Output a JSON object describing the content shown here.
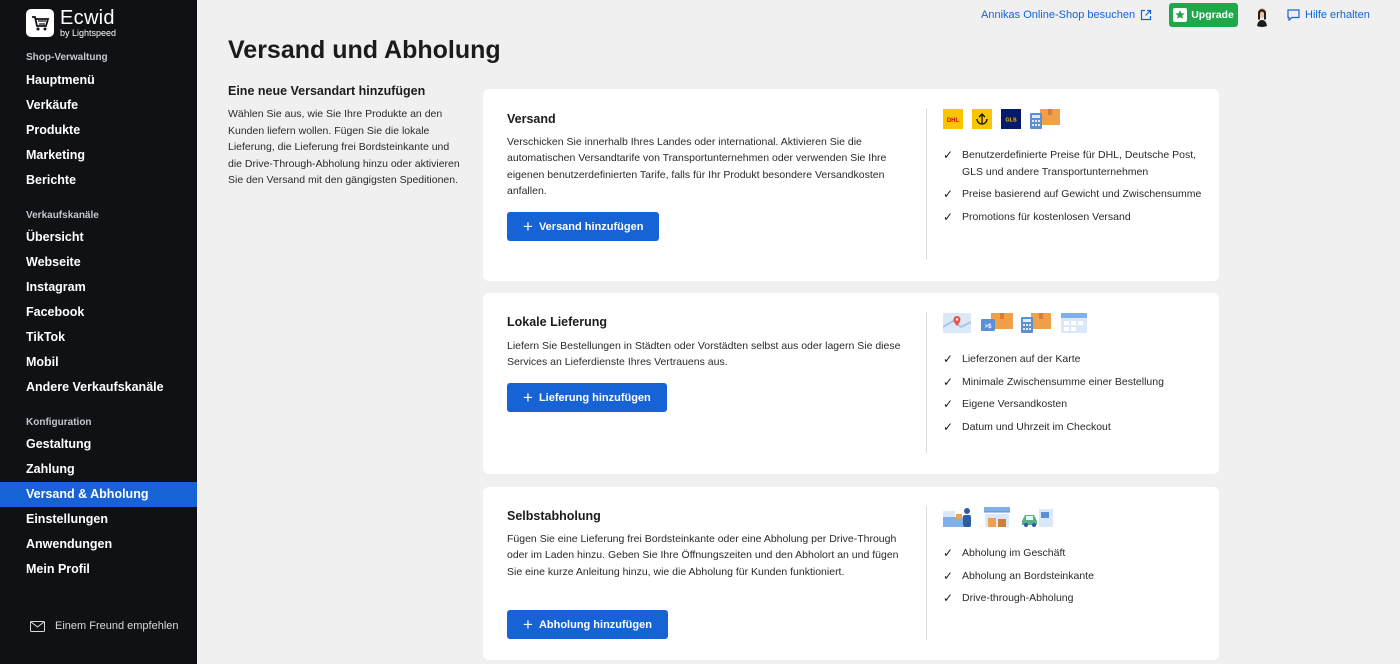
{
  "app": {
    "name": "Ecwid",
    "sub": "by Lightspeed"
  },
  "sidebar": {
    "section_shop": "Shop-Verwaltung",
    "section_channels": "Verkaufskanäle",
    "section_config": "Konfiguration",
    "shop_items": [
      "Hauptmenü",
      "Verkäufe",
      "Produkte",
      "Marketing",
      "Berichte"
    ],
    "channel_items": [
      "Übersicht",
      "Webseite",
      "Instagram",
      "Facebook",
      "TikTok",
      "Mobil",
      "Andere Verkaufskanäle"
    ],
    "config_items": [
      "Gestaltung",
      "Zahlung",
      "Versand & Abholung",
      "Einstellungen",
      "Anwendungen",
      "Mein Profil"
    ],
    "active_item": "Versand & Abholung",
    "refer_label": "Einem Freund empfehlen"
  },
  "topbar": {
    "visit_label": "Annikas Online-Shop besuchen",
    "upgrade_label": "Upgrade",
    "help_label": "Hilfe erhalten"
  },
  "page": {
    "title": "Versand und Abholung",
    "intro_heading": "Eine neue Versandart hinzufügen",
    "intro_text": "Wählen Sie aus, wie Sie Ihre Produkte an den Kunden liefern wollen. Fügen Sie die lokale Lieferung, die Lieferung frei Bordsteinkante und die Drive-Through-Abholung hinzu oder aktivieren Sie den Versand mit den gängigsten Speditionen."
  },
  "cards": [
    {
      "title": "Versand",
      "description": "Verschicken Sie innerhalb Ihres Landes oder international. Aktivieren Sie die automatischen Versandtarife von Transportunternehmen oder verwenden Sie Ihre eigenen benutzerdefinierten Tarife, falls für Ihr Produkt besondere Versandkosten anfallen.",
      "button": "Versand hinzufügen",
      "icons": [
        "dhl-logo-icon",
        "deutsche-post-logo-icon",
        "gls-logo-icon",
        "calculator-box-icon"
      ],
      "features": [
        "Benutzerdefinierte Preise für DHL, Deutsche Post, GLS und andere Transportunternehmen",
        "Preise basierend auf Gewicht und Zwischensumme",
        "Promotions für kostenlosen Versand"
      ]
    },
    {
      "title": "Lokale Lieferung",
      "description": "Liefern Sie Bestellungen in Städten oder Vorstädten selbst aus oder lagern Sie diese Services an Lieferdienste Ihres Vertrauens aus.",
      "button": "Lieferung hinzufügen",
      "icons": [
        "map-pin-icon",
        "min-subtotal-box-icon",
        "calculator-box-icon",
        "calendar-icon"
      ],
      "features": [
        "Lieferzonen auf der Karte",
        "Minimale Zwischensumme einer Bestellung",
        "Eigene Versandkosten",
        "Datum und Uhrzeit im Checkout"
      ]
    },
    {
      "title": "Selbstabholung",
      "description": "Fügen Sie eine Lieferung frei Bordsteinkante oder eine Abholung per Drive-Through oder im Laden hinzu. Geben Sie Ihre Öffnungszeiten und den Abholort an und fügen Sie eine kurze Anleitung hinzu, wie die Abholung für Kunden funktioniert.",
      "button": "Abholung hinzufügen",
      "icons": [
        "store-pickup-icon",
        "curbside-pickup-icon",
        "drive-through-icon"
      ],
      "features": [
        "Abholung im Geschäft",
        "Abholung an Bordsteinkante",
        "Drive-through-Abholung"
      ]
    }
  ]
}
